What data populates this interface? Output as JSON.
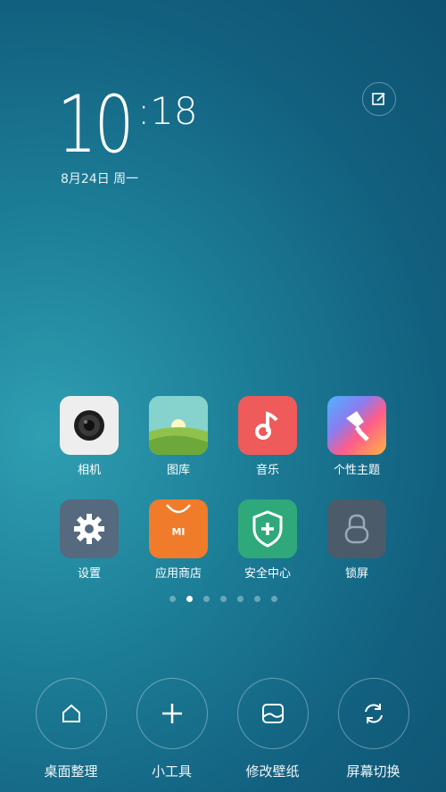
{
  "clock": {
    "hour": "10",
    "minute": ":18",
    "date": "8月24日 周一"
  },
  "apps": [
    {
      "label": "相机",
      "icon": "camera-icon",
      "color": "#eeeeee"
    },
    {
      "label": "图库",
      "icon": "gallery-icon",
      "color": "#8fd0c8"
    },
    {
      "label": "音乐",
      "icon": "music-icon",
      "color": "#ef5a5a"
    },
    {
      "label": "个性主题",
      "icon": "theme-brush-icon",
      "color": "#8a7df0"
    },
    {
      "label": "设置",
      "icon": "gear-icon",
      "color": "#556a7e"
    },
    {
      "label": "应用商店",
      "icon": "store-bag-icon",
      "mi_text": "MI",
      "color": "#f07b2a"
    },
    {
      "label": "安全中心",
      "icon": "shield-plus-icon",
      "color": "#2fa97a"
    },
    {
      "label": "锁屏",
      "icon": "lock-icon",
      "color": "#4b5b6a"
    }
  ],
  "pager": {
    "count": 7,
    "active": 1
  },
  "toolbar": [
    {
      "label": "桌面整理",
      "icon": "home-icon"
    },
    {
      "label": "小工具",
      "icon": "plus-icon"
    },
    {
      "label": "修改壁纸",
      "icon": "wallpaper-icon"
    },
    {
      "label": "屏幕切换",
      "icon": "refresh-icon"
    }
  ]
}
